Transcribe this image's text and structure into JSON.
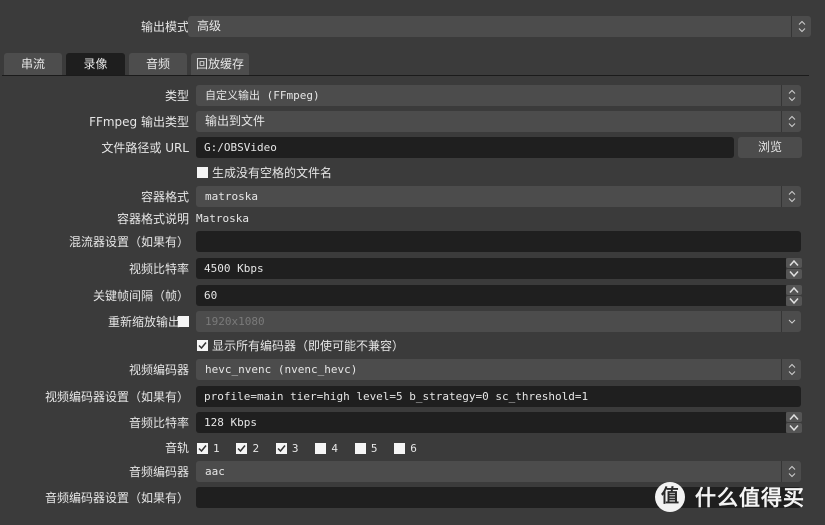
{
  "output_mode": {
    "label": "输出模式",
    "value": "高级"
  },
  "tabs": [
    {
      "label": "串流",
      "active": false
    },
    {
      "label": "录像",
      "active": true
    },
    {
      "label": "音频",
      "active": false
    },
    {
      "label": "回放缓存",
      "active": false
    }
  ],
  "recording": {
    "type": {
      "label": "类型",
      "value": "自定义输出 (FFmpeg)"
    },
    "ffmpeg_output_type": {
      "label": "FFmpeg 输出类型",
      "value": "输出到文件"
    },
    "file_path": {
      "label": "文件路径或 URL",
      "value": "G:/OBSVideo",
      "browse_label": "浏览"
    },
    "no_space_filename": {
      "label": "生成没有空格的文件名",
      "checked": false
    },
    "container_format": {
      "label": "容器格式",
      "value": "matroska"
    },
    "container_desc": {
      "label": "容器格式说明",
      "value": "Matroska"
    },
    "muxer_settings": {
      "label": "混流器设置（如果有）",
      "value": ""
    },
    "video_bitrate": {
      "label": "视频比特率",
      "value": "4500 Kbps"
    },
    "keyframe_interval": {
      "label": "关键帧间隔（帧）",
      "value": "60"
    },
    "rescale_output": {
      "label": "重新缩放输出",
      "checked": false,
      "value": "1920x1080"
    },
    "show_all_encoders": {
      "label": "显示所有编码器（即使可能不兼容）",
      "checked": true
    },
    "video_encoder": {
      "label": "视频编码器",
      "value": "hevc_nvenc (nvenc_hevc)"
    },
    "video_encoder_settings": {
      "label": "视频编码器设置（如果有）",
      "value": "profile=main tier=high level=5 b_strategy=0 sc_threshold=1"
    },
    "audio_bitrate": {
      "label": "音频比特率",
      "value": "128 Kbps"
    },
    "audio_tracks": {
      "label": "音轨",
      "tracks": [
        {
          "label": "1",
          "checked": true
        },
        {
          "label": "2",
          "checked": true
        },
        {
          "label": "3",
          "checked": true
        },
        {
          "label": "4",
          "checked": false
        },
        {
          "label": "5",
          "checked": false
        },
        {
          "label": "6",
          "checked": false
        }
      ]
    },
    "audio_encoder": {
      "label": "音频编码器",
      "value": "aac"
    },
    "audio_encoder_settings": {
      "label": "音频编码器设置（如果有）",
      "value": ""
    }
  },
  "watermark": {
    "logo_char": "值",
    "text": "什么值得买"
  }
}
